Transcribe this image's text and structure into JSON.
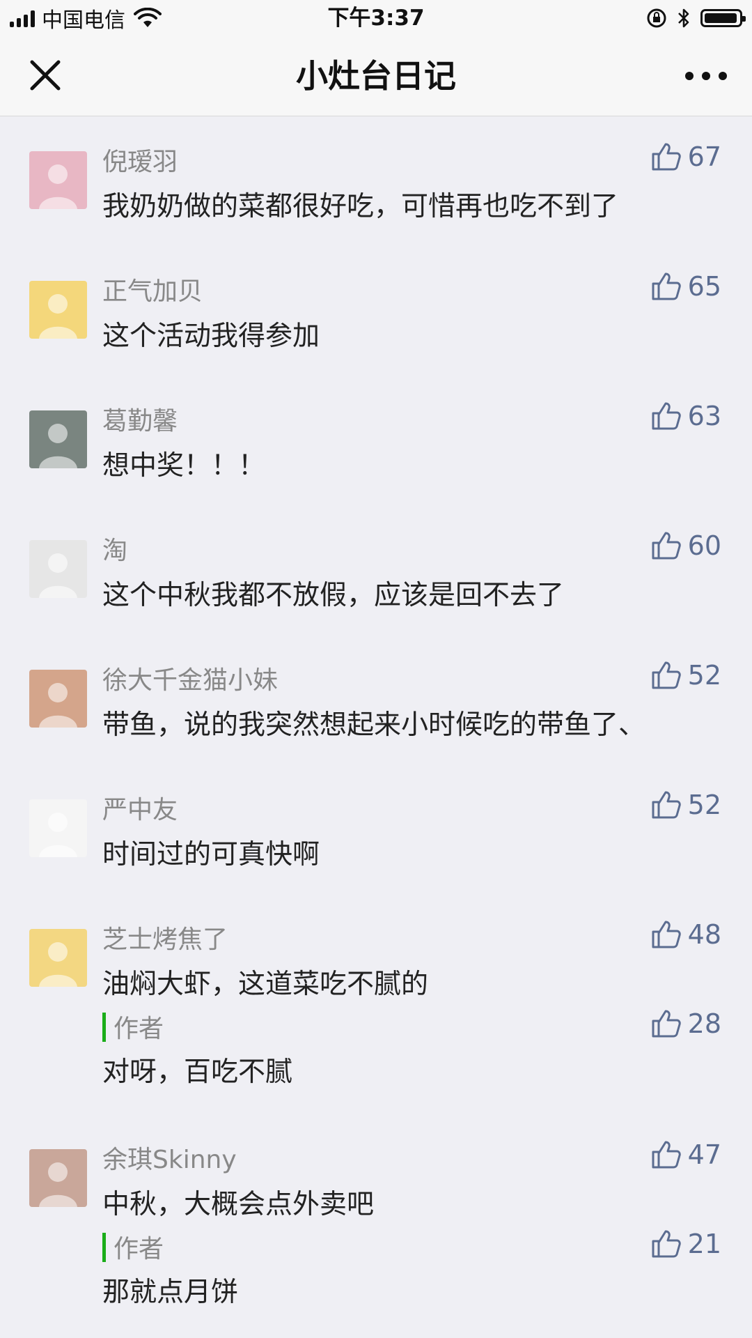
{
  "status_bar": {
    "carrier": "中国电信",
    "time": "下午3:37",
    "battery_level": 0.95
  },
  "nav": {
    "title": "小灶台日记"
  },
  "comments": [
    {
      "name": "倪瑷羽",
      "text": "我奶奶做的菜都很好吃，可惜再也吃不到了",
      "likes": "67",
      "avatar_color": "#e8b7c4"
    },
    {
      "name": "正气加贝",
      "text": "这个活动我得参加",
      "likes": "65",
      "avatar_color": "#f4d77b"
    },
    {
      "name": "葛勤馨",
      "text": "想中奖！！！",
      "likes": "63",
      "avatar_color": "#7a8580"
    },
    {
      "name": "淘",
      "text": "这个中秋我都不放假，应该是回不去了",
      "likes": "60",
      "avatar_color": "#e6e6e6"
    },
    {
      "name": "徐大千金猫小妹",
      "text": "带鱼，说的我突然想起来小时候吃的带鱼了、",
      "likes": "52",
      "avatar_color": "#d4a58b"
    },
    {
      "name": "严中友",
      "text": "时间过的可真快啊",
      "likes": "52",
      "avatar_color": "#f5f5f5"
    },
    {
      "name": "芝士烤焦了",
      "text": "油焖大虾，这道菜吃不腻的",
      "likes": "48",
      "avatar_color": "#f3d782",
      "reply": {
        "label": "作者",
        "text": "对呀，百吃不腻",
        "likes": "28"
      }
    },
    {
      "name": "余琪Skinny",
      "text": "中秋，大概会点外卖吧",
      "likes": "47",
      "avatar_color": "#c9a79a",
      "reply": {
        "label": "作者",
        "text": "那就点月饼",
        "likes": "21"
      }
    }
  ]
}
